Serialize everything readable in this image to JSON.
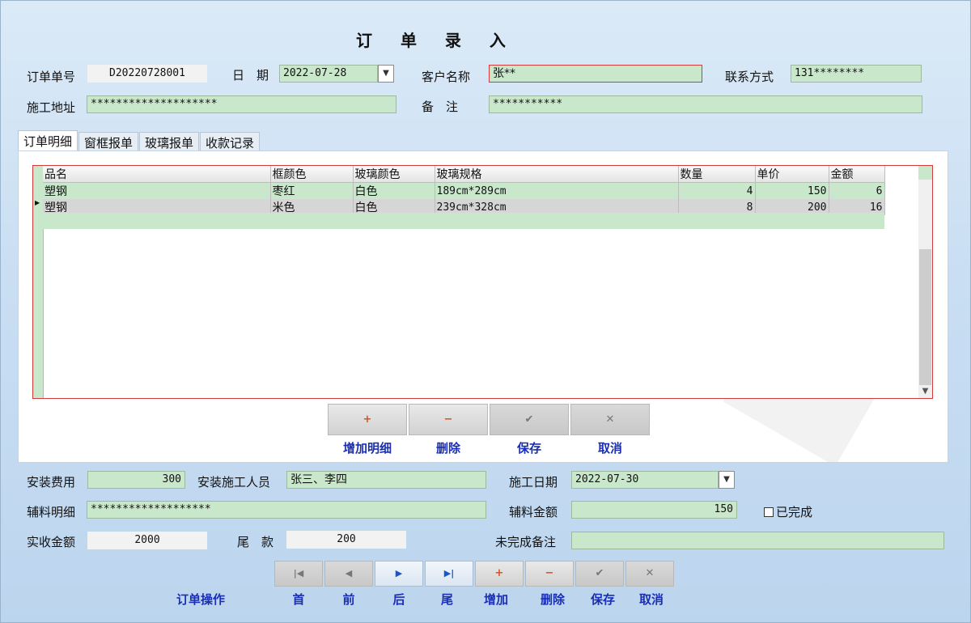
{
  "title": "订 单 录 入",
  "header": {
    "order_no_label": "订单单号",
    "order_no": "D20220728001",
    "date_label": "日　期",
    "date": "2022-07-28",
    "customer_label": "客户名称",
    "customer": "张**",
    "contact_label": "联系方式",
    "contact": "131********",
    "address_label": "施工地址",
    "address": "********************",
    "remark_label": "备　注",
    "remark": "***********"
  },
  "tabs": [
    "订单明细",
    "窗框报单",
    "玻璃报单",
    "收款记录"
  ],
  "grid": {
    "columns": [
      "品名",
      "框颜色",
      "玻璃颜色",
      "玻璃规格",
      "数量",
      "单价",
      "金额"
    ],
    "rows": [
      [
        "塑钢",
        "枣红",
        "白色",
        "189cm*289cm",
        "4",
        "150",
        "6"
      ],
      [
        "塑钢",
        "米色",
        "白色",
        "239cm*328cm",
        "8",
        "200",
        "16"
      ]
    ]
  },
  "detail_buttons": {
    "add_label": "增加明细",
    "delete_label": "删除",
    "save_label": "保存",
    "cancel_label": "取消",
    "add_icon": "+",
    "delete_icon": "−",
    "save_icon": "✔",
    "cancel_icon": "✕"
  },
  "footer": {
    "install_fee_label": "安装费用",
    "install_fee": "300",
    "installers_label": "安装施工人员",
    "installers": "张三、李四",
    "work_date_label": "施工日期",
    "work_date": "2022-07-30",
    "material_detail_label": "辅料明细",
    "material_detail": "*******************",
    "material_amount_label": "辅料金额",
    "material_amount": "150",
    "completed_label": "已完成",
    "received_label": "实收金额",
    "received": "2000",
    "balance_label": "尾　款",
    "balance": "200",
    "unfinished_note_label": "未完成备注",
    "unfinished_note": ""
  },
  "order_ops": {
    "section_label": "订单操作",
    "first_label": "首",
    "prev_label": "前",
    "next_label": "后",
    "last_label": "尾",
    "add_label": "增加",
    "delete_label": "删除",
    "save_label": "保存",
    "cancel_label": "取消",
    "first_icon": "|◀",
    "prev_icon": "◀",
    "next_icon": "▶",
    "last_icon": "▶|",
    "add_icon": "+",
    "delete_icon": "−",
    "save_icon": "✔",
    "cancel_icon": "✕"
  },
  "colors": {
    "field_bg": "#c9e7cb",
    "label_blue": "#1a2fb5",
    "alert_red": "#d23b3b",
    "accent_orange": "#e0501b"
  }
}
